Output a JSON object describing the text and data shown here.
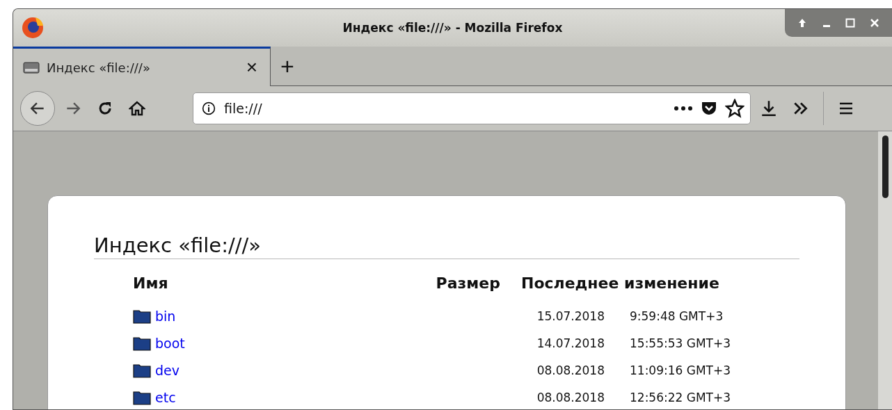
{
  "window": {
    "title": "Индекс «file:///» - Mozilla Firefox"
  },
  "tabs": [
    {
      "label": "Индекс «file:///»",
      "selected": true,
      "close": "×"
    }
  ],
  "new_tab": "+",
  "address_bar": {
    "value": "file:///"
  },
  "page": {
    "heading": "Индекс «file:///»",
    "columns": [
      "Имя",
      "Размер",
      "Последнее изменение"
    ],
    "rows": [
      {
        "name": "bin",
        "date": "15.07.2018",
        "time": "9:59:48 GMT+3"
      },
      {
        "name": "boot",
        "date": "14.07.2018",
        "time": "15:55:53 GMT+3"
      },
      {
        "name": "dev",
        "date": "08.08.2018",
        "time": "11:09:16 GMT+3"
      },
      {
        "name": "etc",
        "date": "08.08.2018",
        "time": "12:56:22 GMT+3"
      }
    ]
  }
}
